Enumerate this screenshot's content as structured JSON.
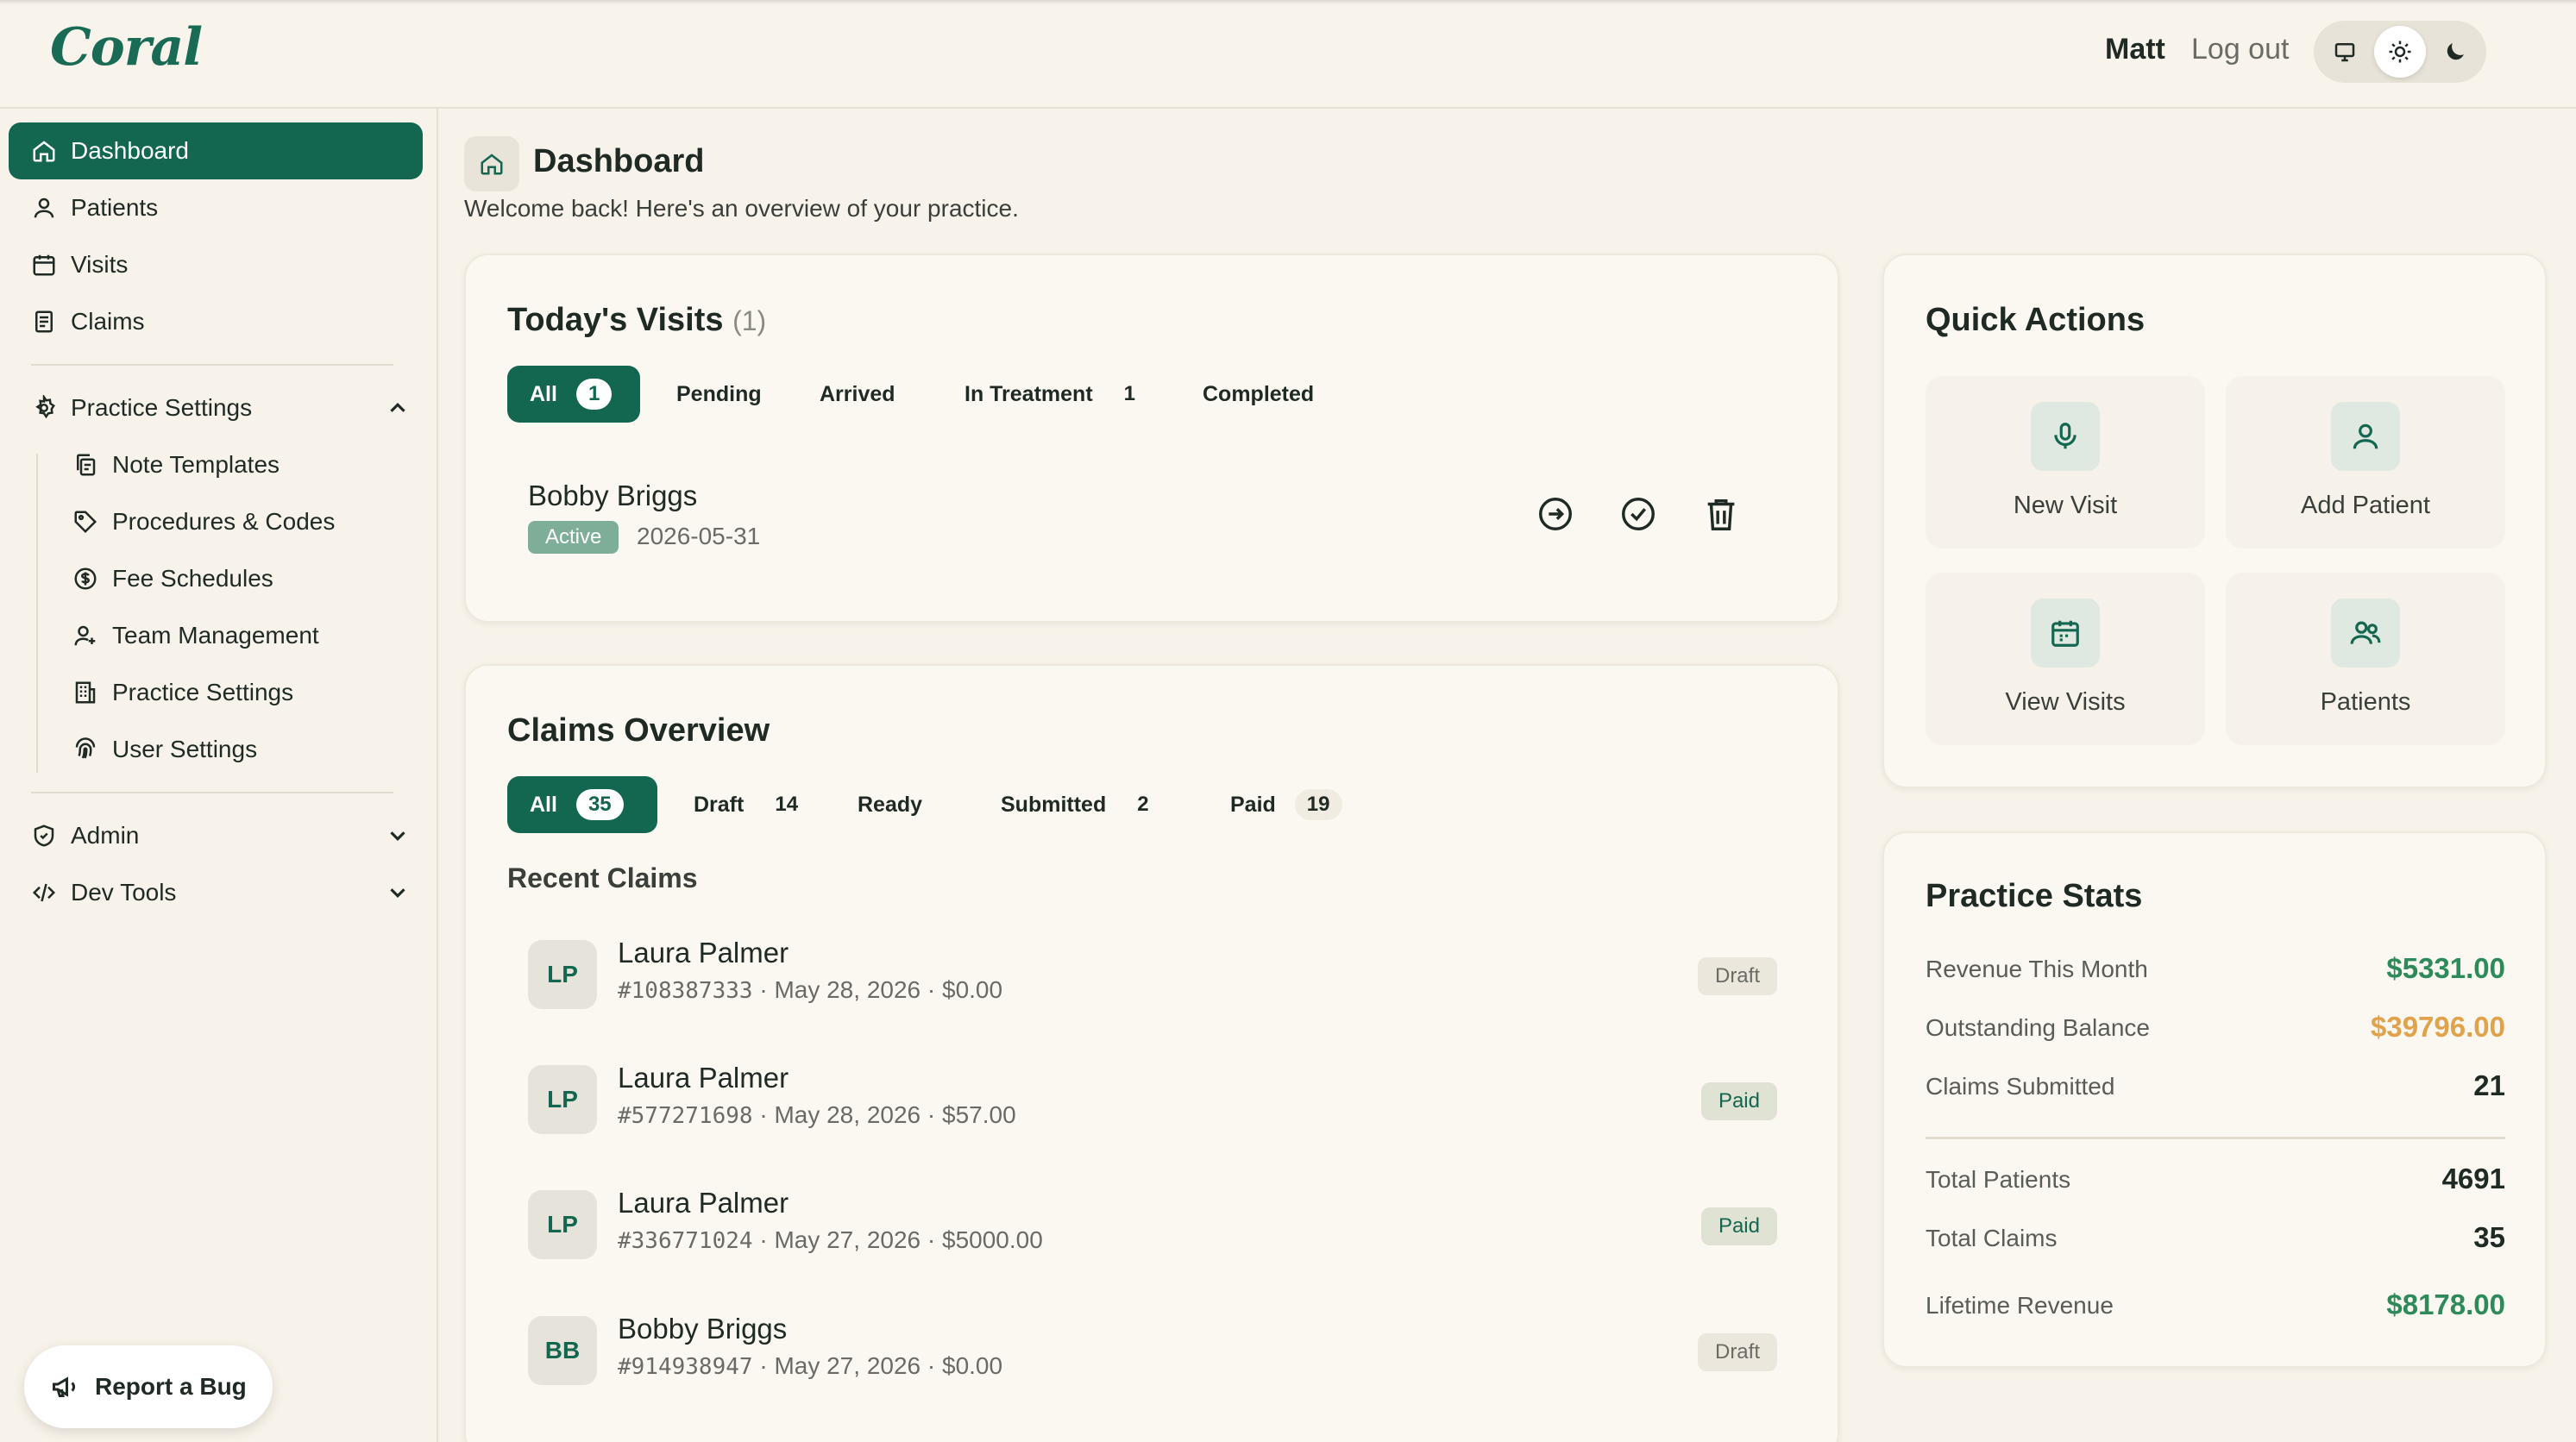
{
  "brand": {
    "logo": "Coral",
    "accent": "#13664f"
  },
  "header": {
    "user": "Matt",
    "logout": "Log out",
    "theme_options": [
      "monitor-icon",
      "sun-icon",
      "moon-icon"
    ],
    "theme_selected": "sun-icon"
  },
  "sidebar": {
    "items": [
      {
        "label": "Dashboard",
        "icon": "home-icon",
        "active": true
      },
      {
        "label": "Patients",
        "icon": "user-icon"
      },
      {
        "label": "Visits",
        "icon": "calendar-icon"
      },
      {
        "label": "Claims",
        "icon": "receipt-icon"
      }
    ],
    "settings": {
      "label": "Practice Settings",
      "expanded": true,
      "children": [
        {
          "label": "Note Templates",
          "icon": "copy-icon"
        },
        {
          "label": "Procedures & Codes",
          "icon": "tag-icon"
        },
        {
          "label": "Fee Schedules",
          "icon": "dollar-circle-icon"
        },
        {
          "label": "Team Management",
          "icon": "user-plus-icon"
        },
        {
          "label": "Practice Settings",
          "icon": "building-icon"
        },
        {
          "label": "User Settings",
          "icon": "fingerprint-icon"
        }
      ]
    },
    "admin": "Admin",
    "dev_tools": "Dev Tools",
    "report_bug": "Report a Bug"
  },
  "page": {
    "title": "Dashboard",
    "subtitle": "Welcome back! Here's an overview of your practice."
  },
  "todays_visits": {
    "title": "Today's Visits",
    "count": "(1)",
    "tabs": [
      {
        "label": "All",
        "count": "1",
        "active": true
      },
      {
        "label": "Pending",
        "count": ""
      },
      {
        "label": "Arrived",
        "count": ""
      },
      {
        "label": "In Treatment",
        "count": "1"
      },
      {
        "label": "Completed",
        "count": ""
      }
    ],
    "visit": {
      "name": "Bobby Briggs",
      "status": "Active",
      "date": "2026-05-31"
    }
  },
  "claims_overview": {
    "title": "Claims Overview",
    "tabs": [
      {
        "label": "All",
        "count": "35",
        "active": true
      },
      {
        "label": "Draft",
        "count": "14"
      },
      {
        "label": "Ready",
        "count": ""
      },
      {
        "label": "Submitted",
        "count": "2"
      },
      {
        "label": "Paid",
        "count": "19"
      }
    ],
    "recent_label": "Recent Claims",
    "recent": [
      {
        "initials": "LP",
        "name": "Laura Palmer",
        "number": "#108387333",
        "date": "May 28, 2026",
        "amount": "$0.00",
        "status": "Draft"
      },
      {
        "initials": "LP",
        "name": "Laura Palmer",
        "number": "#577271698",
        "date": "May 28, 2026",
        "amount": "$57.00",
        "status": "Paid"
      },
      {
        "initials": "LP",
        "name": "Laura Palmer",
        "number": "#336771024",
        "date": "May 27, 2026",
        "amount": "$5000.00",
        "status": "Paid"
      },
      {
        "initials": "BB",
        "name": "Bobby Briggs",
        "number": "#914938947",
        "date": "May 27, 2026",
        "amount": "$0.00",
        "status": "Draft"
      }
    ]
  },
  "quick_actions": {
    "title": "Quick Actions",
    "items": [
      {
        "label": "New Visit",
        "icon": "microphone-icon"
      },
      {
        "label": "Add Patient",
        "icon": "user-icon"
      },
      {
        "label": "View Visits",
        "icon": "calendar-icon"
      },
      {
        "label": "Patients",
        "icon": "users-icon"
      }
    ]
  },
  "practice_stats": {
    "title": "Practice Stats",
    "rows": [
      {
        "label": "Revenue This Month",
        "value": "$5331.00",
        "color": "#2e8a5a"
      },
      {
        "label": "Outstanding Balance",
        "value": "$39796.00",
        "color": "#e0a24a"
      },
      {
        "label": "Claims Submitted",
        "value": "21",
        "color": "#1f2a24"
      },
      {
        "label": "Total Patients",
        "value": "4691",
        "color": "#1f2a24"
      },
      {
        "label": "Total Claims",
        "value": "35",
        "color": "#1f2a24"
      },
      {
        "label": "Lifetime Revenue",
        "value": "$8178.00",
        "color": "#2e8a5a"
      }
    ]
  }
}
